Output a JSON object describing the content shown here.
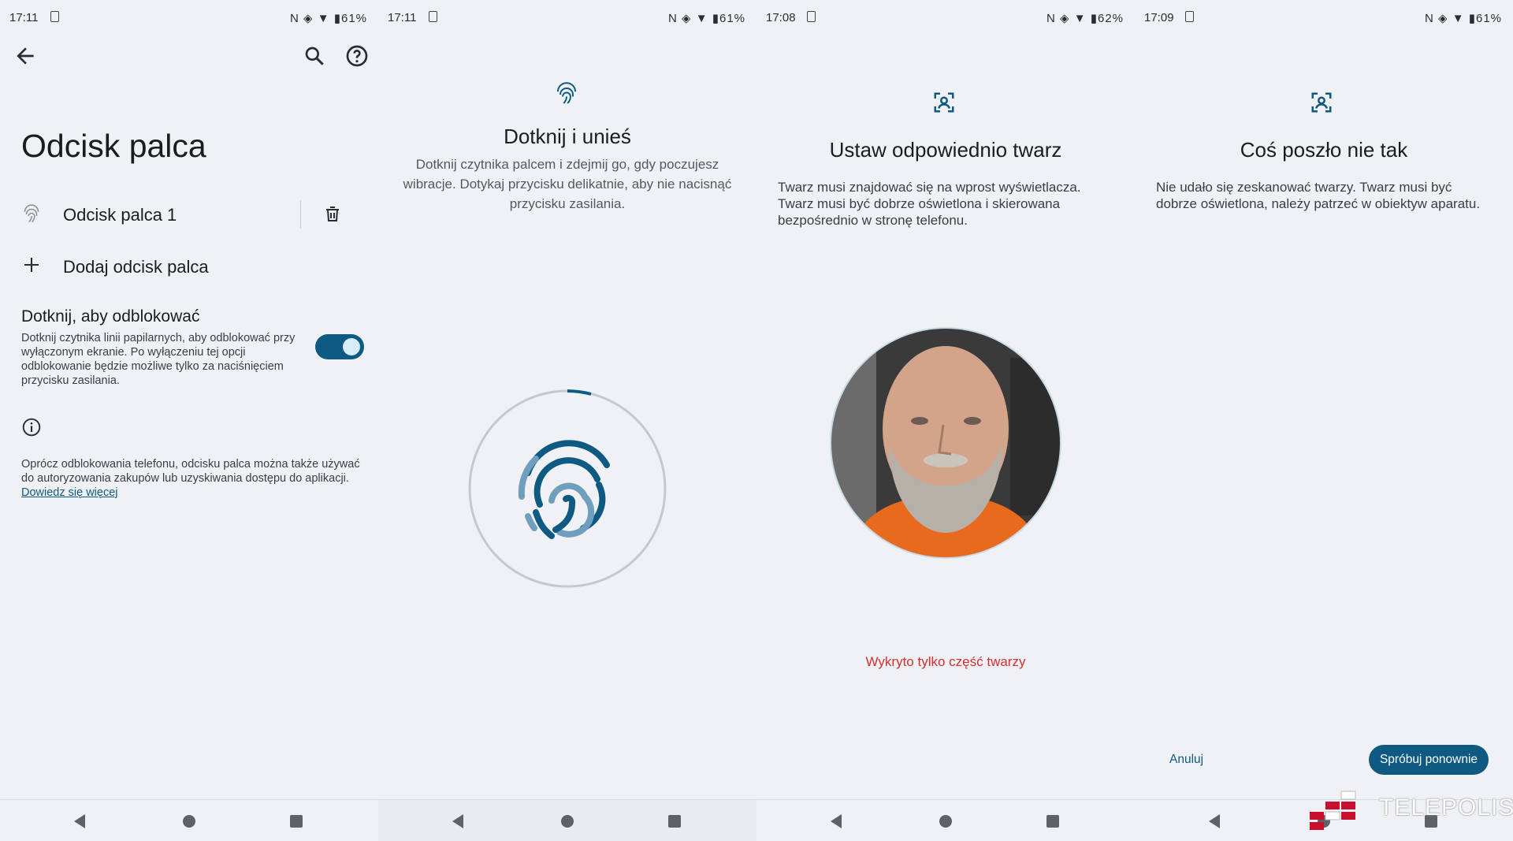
{
  "panels": [
    {
      "status": {
        "time": "17:11",
        "right": "N ◈ ▼ ▮61%"
      },
      "title": "Odcisk palca",
      "fingerprint_item": "Odcisk palca 1",
      "add_label": "Dodaj odcisk palca",
      "setting": {
        "title": "Dotknij, aby odblokować",
        "description": "Dotknij czytnika linii papilarnych, aby odblokować przy wyłączonym ekranie. Po wyłączeniu tej opcji odblokowanie będzie możliwe tylko za naciśnięciem przycisku zasilania.",
        "enabled": true
      },
      "info_text": "Oprócz odblokowania telefonu, odcisku palca można także używać do autoryzowania zakupów lub uzyskiwania dostępu do aplikacji.",
      "info_link": "Dowiedz się więcej"
    },
    {
      "status": {
        "time": "17:11",
        "right": "N ◈ ▼ ▮61%"
      },
      "title": "Dotknij i unieś",
      "description": "Dotknij czytnika palcem i zdejmij go, gdy poczujesz wibracje. Dotykaj przycisku delikatnie, aby nie nacisnąć przycisku zasilania."
    },
    {
      "status": {
        "time": "17:08",
        "right": "N ◈ ▼ ▮62%"
      },
      "title": "Ustaw odpowiednio twarz",
      "description": "Twarz musi znajdować się na wprost wyświetlacza. Twarz musi być dobrze oświetlona i skierowana bezpośrednio w stronę telefonu.",
      "error": "Wykryto tylko część twarzy"
    },
    {
      "status": {
        "time": "17:09",
        "right": "N ◈ ▼ ▮61%"
      },
      "title": "Coś poszło nie tak",
      "description": "Nie udało się zeskanować twarzy. Twarz musi być dobrze oświetlona, należy patrzeć w obiektyw aparatu.",
      "cancel_label": "Anuluj",
      "retry_label": "Spróbuj ponownie"
    }
  ],
  "watermark": "TELEPOLIS",
  "colors": {
    "accent": "#0f5a83",
    "error": "#d32f2f",
    "background": "#eff1f4"
  }
}
